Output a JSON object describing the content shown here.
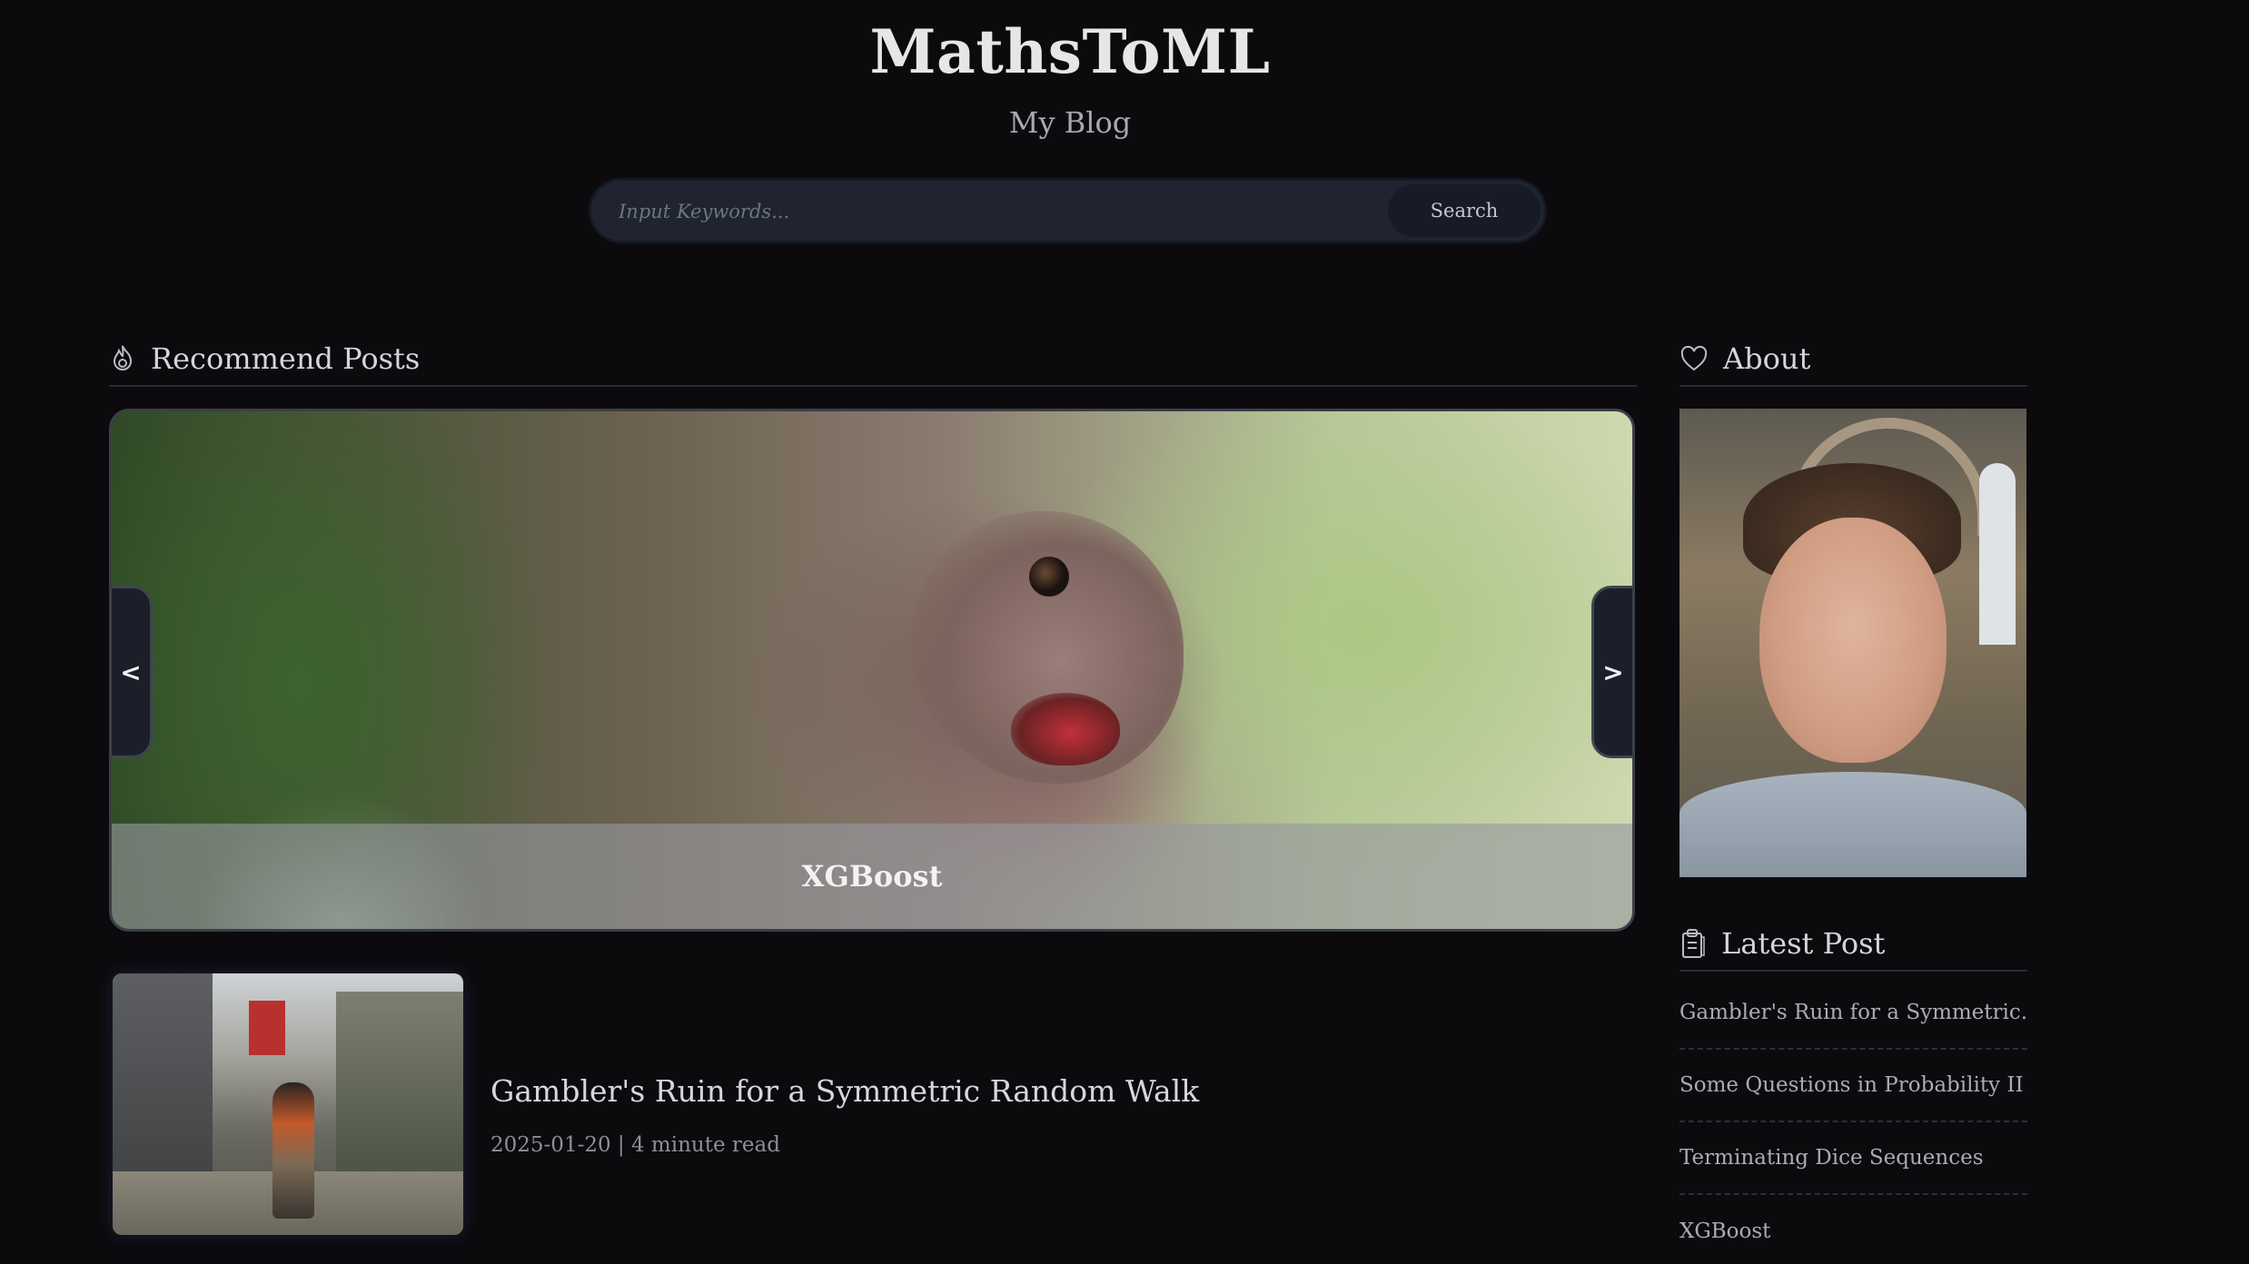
{
  "header": {
    "site_title": "MathsToML",
    "subtitle": "My Blog"
  },
  "search": {
    "placeholder": "Input Keywords...",
    "button_label": "Search"
  },
  "recommend": {
    "heading": "Recommend Posts",
    "icon": "fire-icon",
    "carousel": {
      "caption": "XGBoost",
      "prev_label": "<",
      "next_label": ">"
    }
  },
  "posts": [
    {
      "title": "Gambler's Ruin for a Symmetric Random Walk",
      "meta": "2025-01-20 | 4 minute read"
    }
  ],
  "about": {
    "heading": "About",
    "icon": "heart-icon"
  },
  "latest": {
    "heading": "Latest Post",
    "icon": "clipboard-icon",
    "items": [
      "Gambler's Ruin for a Symmetric...",
      "Some Questions in Probability II",
      "Terminating Dice Sequences",
      "XGBoost"
    ]
  },
  "colors": {
    "background": "#0c0a0d",
    "search_bg": "#1f2430",
    "accent_text": "#e6e6e8"
  }
}
